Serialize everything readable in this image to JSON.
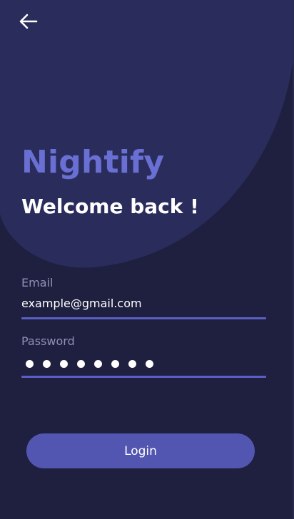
{
  "colors": {
    "background": "#1f2040",
    "blob": "#2a2d5c",
    "brand": "#6a6fd4",
    "accent": "#5a5fc4",
    "button": "#5256b0",
    "label": "#8e91b5"
  },
  "header": {
    "back_icon": "arrow-left-icon"
  },
  "brand": {
    "name": "Nightify"
  },
  "welcome": {
    "text": "Welcome back !"
  },
  "form": {
    "email": {
      "label": "Email",
      "value": "example@gmail.com"
    },
    "password": {
      "label": "Password",
      "masked_length": 8
    },
    "login_label": "Login"
  }
}
